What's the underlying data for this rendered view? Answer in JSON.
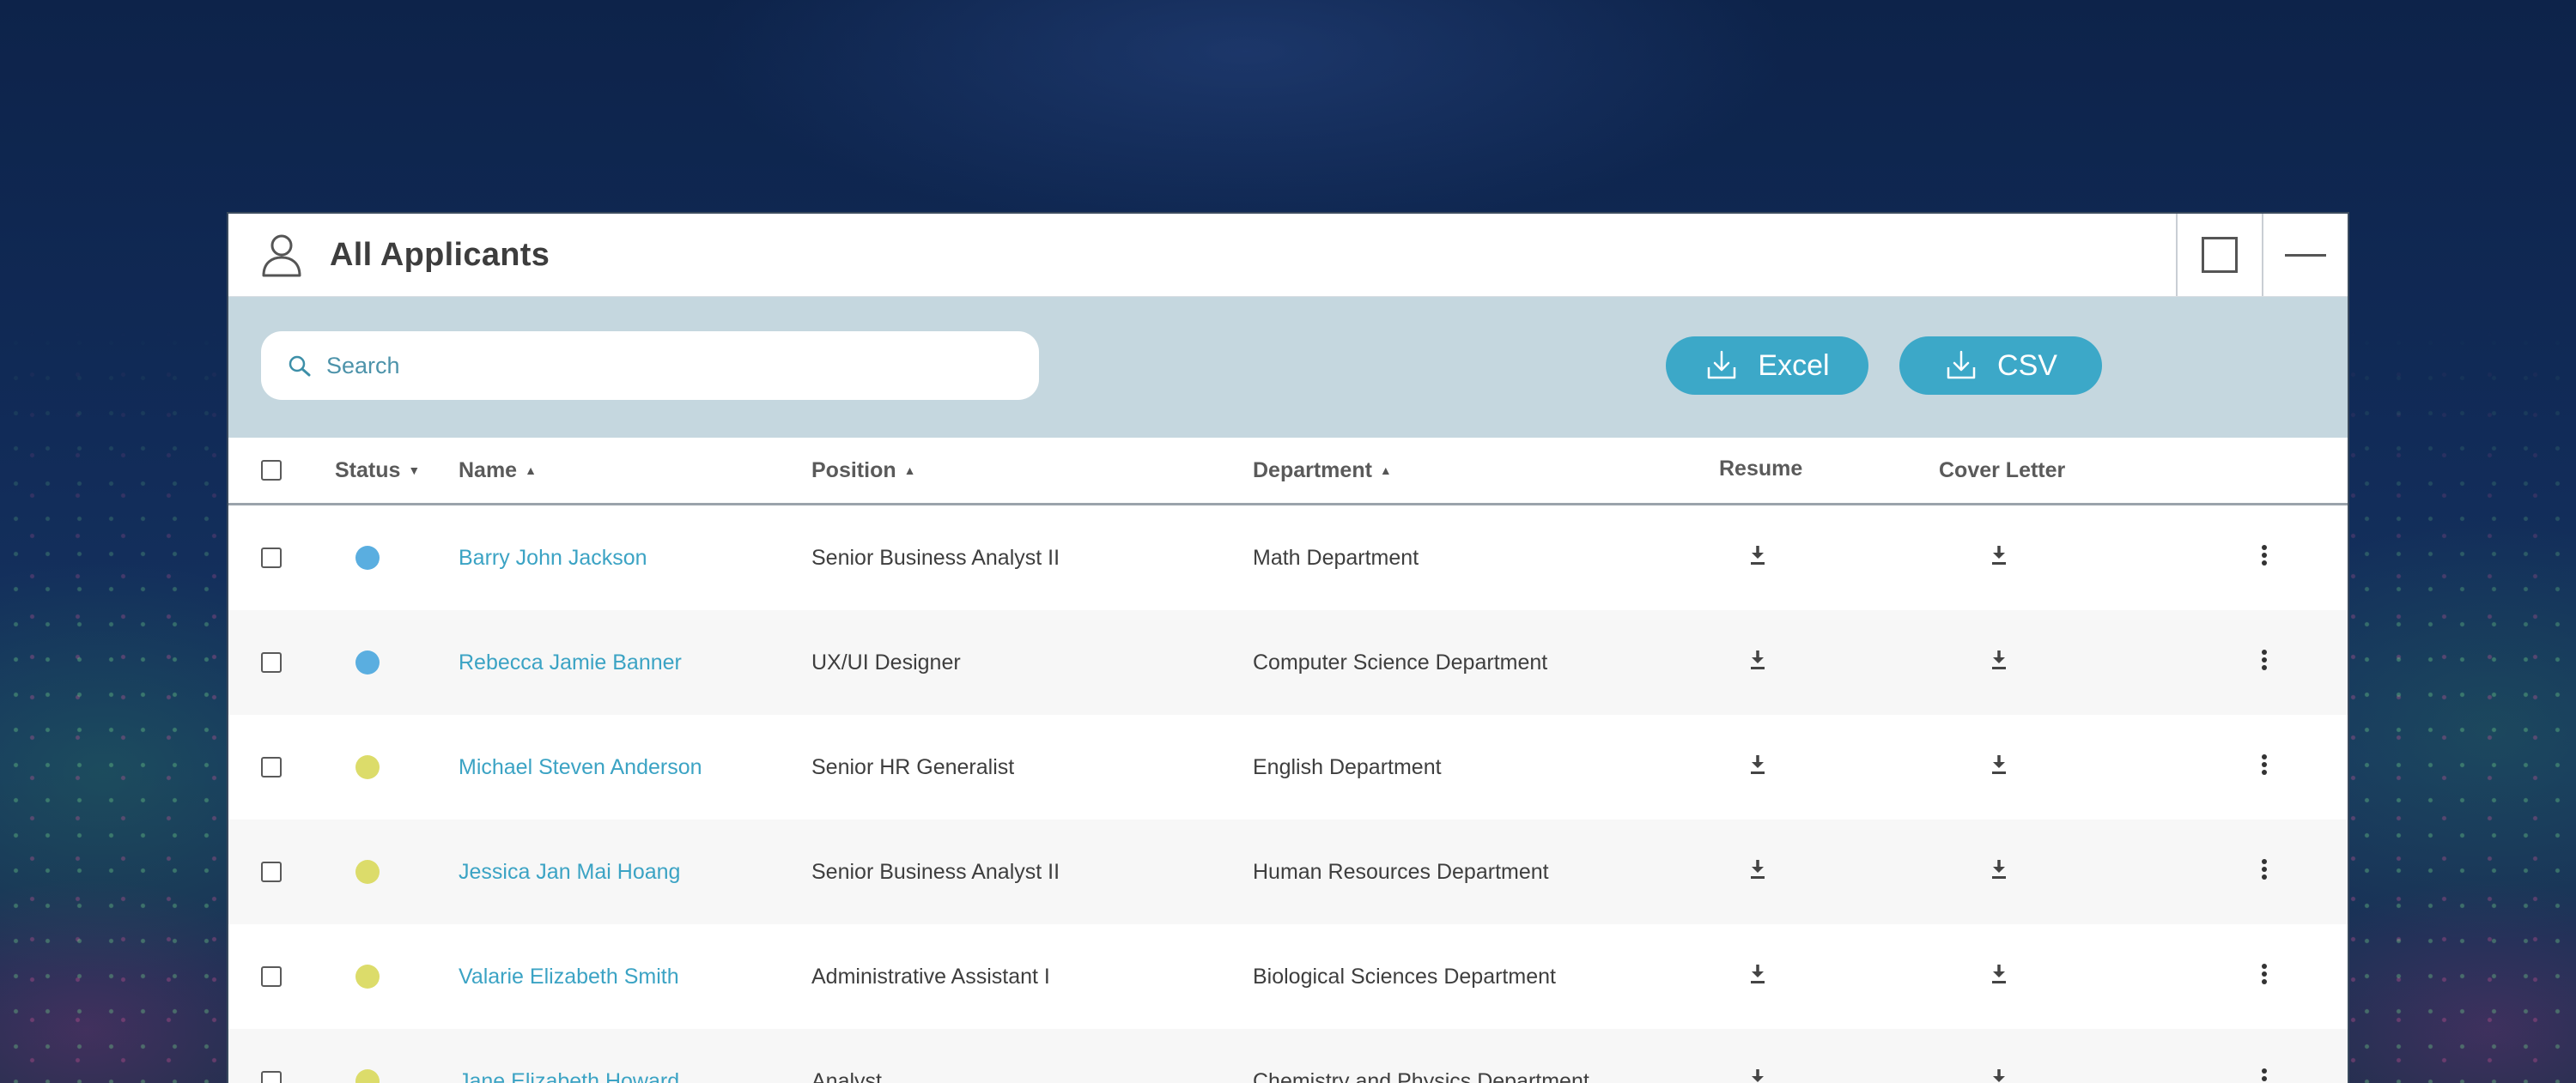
{
  "window": {
    "title": "All Applicants"
  },
  "toolbar": {
    "search_placeholder": "Search",
    "excel_label": "Excel",
    "csv_label": "CSV"
  },
  "colors": {
    "accent": "#3ca8c8",
    "status_blue": "#5aaee0",
    "status_yellow": "#dcdc6a",
    "toolbar_bg": "#c5d7df"
  },
  "table": {
    "headers": {
      "status": "Status",
      "name": "Name",
      "position": "Position",
      "department": "Department",
      "resume": "Resume",
      "cover_letter": "Cover Letter"
    },
    "rows": [
      {
        "status": "blue",
        "name": "Barry John Jackson",
        "position": "Senior Business Analyst II",
        "department": "Math Department"
      },
      {
        "status": "blue",
        "name": "Rebecca Jamie Banner",
        "position": "UX/UI Designer",
        "department": "Computer Science Department"
      },
      {
        "status": "yellow",
        "name": "Michael Steven Anderson",
        "position": "Senior HR Generalist",
        "department": "English Department"
      },
      {
        "status": "yellow",
        "name": "Jessica Jan Mai Hoang",
        "position": "Senior Business Analyst II",
        "department": "Human Resources Department"
      },
      {
        "status": "yellow",
        "name": "Valarie Elizabeth Smith",
        "position": "Administrative Assistant I",
        "department": "Biological Sciences Department"
      },
      {
        "status": "yellow",
        "name": "Jane Elizabeth Howard",
        "position": "Analyst",
        "department": "Chemistry and Physics Department"
      }
    ]
  }
}
